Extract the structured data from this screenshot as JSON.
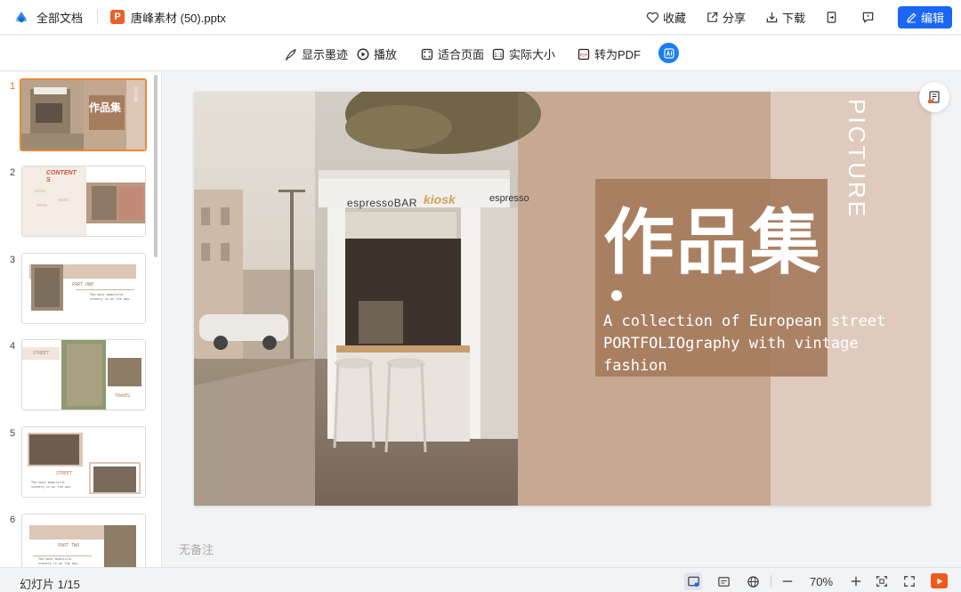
{
  "header": {
    "all_docs": "全部文档",
    "file_icon_letter": "P",
    "file_name": "唐峰素材 (50).pptx",
    "favorite": "收藏",
    "share": "分享",
    "download": "下载",
    "edit": "编辑"
  },
  "toolbar": {
    "ink": "显示墨迹",
    "play": "播放",
    "fit_page": "适合页面",
    "actual_size": "实际大小",
    "to_pdf": "转为PDF"
  },
  "sidebar": {
    "slides": [
      {
        "num": "1"
      },
      {
        "num": "2"
      },
      {
        "num": "3"
      },
      {
        "num": "4"
      },
      {
        "num": "5"
      },
      {
        "num": "6"
      }
    ],
    "thumbs": {
      "s1_title": "作品集",
      "s2_title": "CONTENT\nS",
      "s2_part1": "PART ONE",
      "s2_part2": "PART TWO",
      "s2_part3": "PART THREE",
      "s3_part": "PART  ONE",
      "s3_text": "The most beautiful\nscenery is on the way.",
      "s4_street": "STREET",
      "s4_travel": "TRAVEL",
      "s5_street": "STREET",
      "s5_text": "The most beautiful\nscenery is on the way.",
      "s6_part": "PART  TWO",
      "s6_text": "The most beautiful\nscenery is on the way."
    }
  },
  "slide": {
    "vertical_word": "PICTURE",
    "title": "作品集",
    "line1": "A collection of European street",
    "line2": "PORTFOLIOgraphy with vintage",
    "line3": "fashion",
    "sign_white": "espressoBAR",
    "sign_gold": "kiosk",
    "sign_side": "espresso"
  },
  "notes_placeholder": "无备注",
  "status": {
    "slide_count": "幻灯片 1/15",
    "zoom": "70%"
  },
  "colors": {
    "accent": "#1a66f5",
    "ppt_orange": "#e8622a",
    "active_thumb": "#e88a3a",
    "slide_brown": "#a67c5e",
    "slide_tan": "#c7a992",
    "slide_light": "#dfcbbd"
  }
}
